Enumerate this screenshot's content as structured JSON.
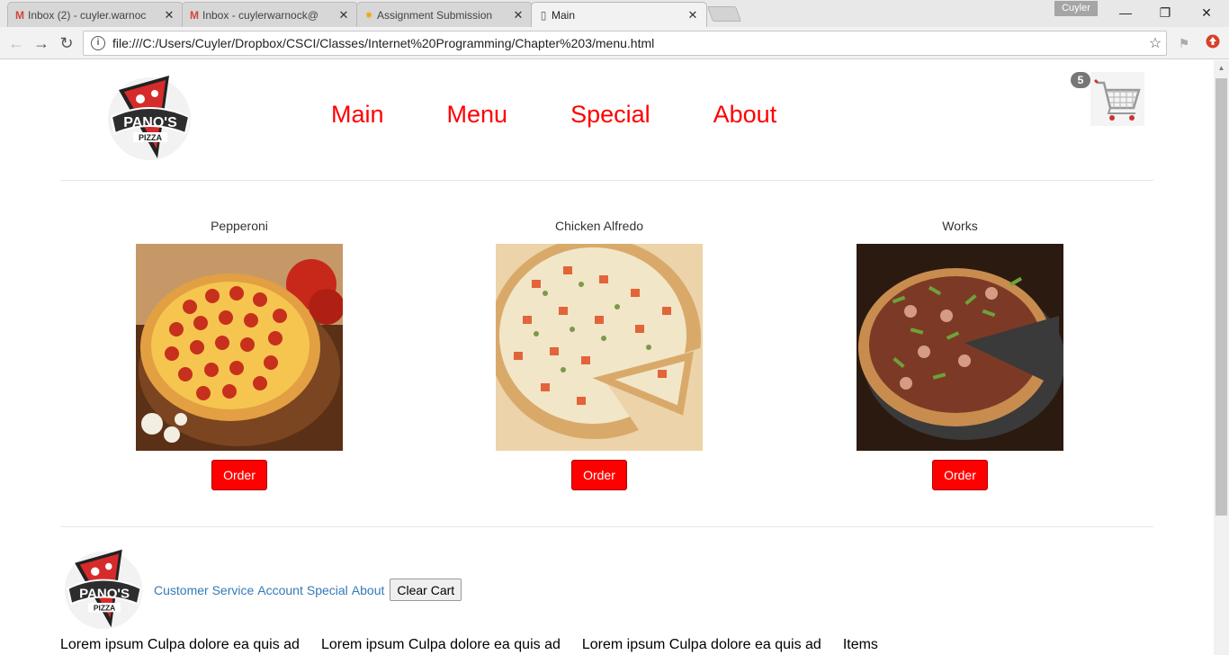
{
  "browser": {
    "tabs": [
      {
        "label": "Inbox (2) - cuyler.warnoc",
        "icon": "gmail-icon"
      },
      {
        "label": "Inbox - cuylerwarnock@",
        "icon": "gmail-icon"
      },
      {
        "label": "Assignment Submission",
        "icon": "sun-icon"
      },
      {
        "label": "Main",
        "icon": "page-icon"
      }
    ],
    "profile_name": "Cuyler",
    "url": "file:///C:/Users/Cuyler/Dropbox/CSCI/Classes/Internet%20Programming/Chapter%203/menu.html"
  },
  "header": {
    "logo_text": "PANO'S",
    "logo_subtext": "PIZZA",
    "nav": [
      "Main",
      "Menu",
      "Special",
      "About"
    ],
    "cart_count": "5"
  },
  "menu_items": [
    {
      "name": "Pepperoni",
      "order_label": "Order"
    },
    {
      "name": "Chicken Alfredo",
      "order_label": "Order"
    },
    {
      "name": "Works",
      "order_label": "Order"
    }
  ],
  "footer": {
    "links": [
      "Customer Service",
      "Account",
      "Special",
      "About"
    ],
    "clear_cart_label": "Clear Cart",
    "columns": [
      "Lorem ipsum Culpa dolore ea quis ad",
      "Lorem ipsum Culpa dolore ea quis ad",
      "Lorem ipsum Culpa dolore ea quis ad",
      "Items"
    ]
  },
  "colors": {
    "accent": "#ff0000",
    "link": "#337ab7"
  }
}
